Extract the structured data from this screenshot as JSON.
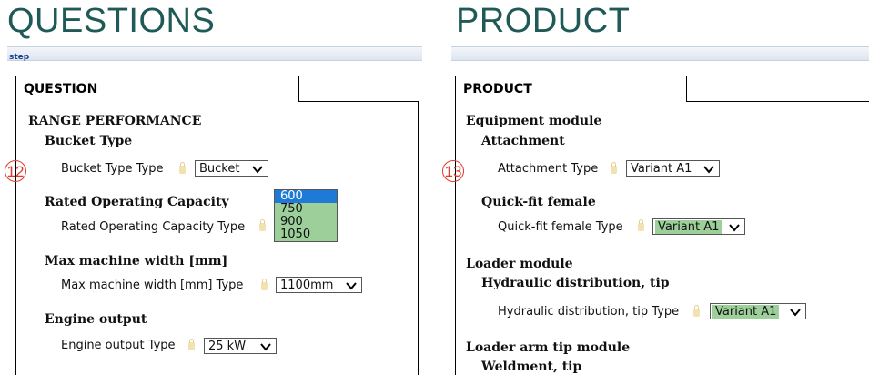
{
  "left": {
    "title": "QUESTIONS",
    "step_label": "step",
    "tab_label": "QUESTION",
    "section": "RANGE PERFORMANCE",
    "marker": "12",
    "groups": [
      {
        "header": "Bucket Type",
        "label": "Bucket Type Type",
        "value": "Bucket"
      },
      {
        "header": "Rated Operating Capacity",
        "label": "Rated Operating Capacity Type",
        "value": "600"
      },
      {
        "header": "Max machine width [mm]",
        "label": "Max machine width [mm] Type",
        "value": "1100mm"
      },
      {
        "header": "Engine output",
        "label": "Engine output Type",
        "value": "25 kW"
      }
    ],
    "capacity_options": [
      "600",
      "750",
      "900",
      "1050"
    ]
  },
  "right": {
    "title": "PRODUCT",
    "tab_label": "PRODUCT",
    "marker": "13",
    "modules": [
      {
        "header": "Equipment module",
        "sub": "Attachment",
        "label": "Attachment Type",
        "value": "Variant A1"
      },
      {
        "sub": "Quick-fit female",
        "label": "Quick-fit female Type",
        "value": "Variant A1"
      },
      {
        "header": "Loader module",
        "sub": "Hydraulic distribution, tip",
        "label": "Hydraulic distribution, tip Type",
        "value": "Variant A1"
      },
      {
        "header": "Loader arm tip module",
        "sub": "Weldment, tip"
      }
    ]
  },
  "colors": {
    "title": "#1f5a57",
    "highlight": "#9ccf9a",
    "selected_option": "#1e7ad6",
    "marker": "#e23a2c"
  }
}
